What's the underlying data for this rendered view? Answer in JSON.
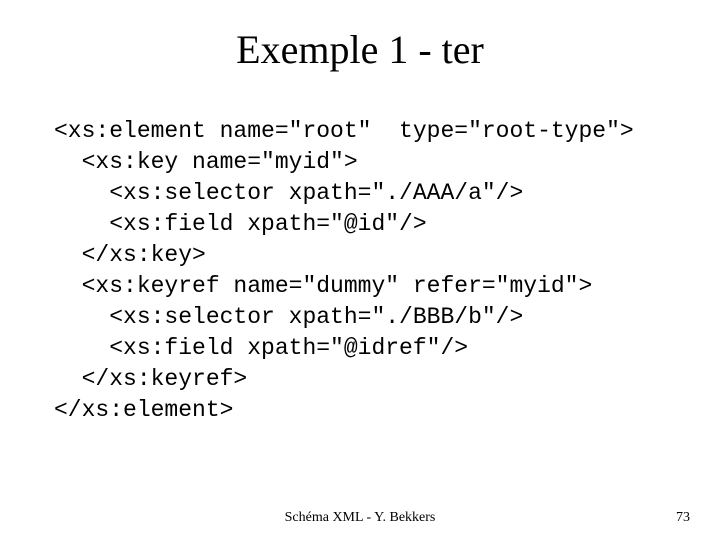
{
  "title": "Exemple 1 - ter",
  "code": {
    "l1": "<xs:element name=\"root\"  type=\"root-type\">",
    "l2": "  <xs:key name=\"myid\">",
    "l3": "    <xs:selector xpath=\"./AAA/a\"/>",
    "l4": "    <xs:field xpath=\"@id\"/>",
    "l5": "  </xs:key>",
    "l6": "  <xs:keyref name=\"dummy\" refer=\"myid\">",
    "l7": "    <xs:selector xpath=\"./BBB/b\"/>",
    "l8": "    <xs:field xpath=\"@idref\"/>",
    "l9": "  </xs:keyref>",
    "l10": "</xs:element>"
  },
  "footer": {
    "center": "Schéma XML - Y. Bekkers",
    "page": "73"
  }
}
